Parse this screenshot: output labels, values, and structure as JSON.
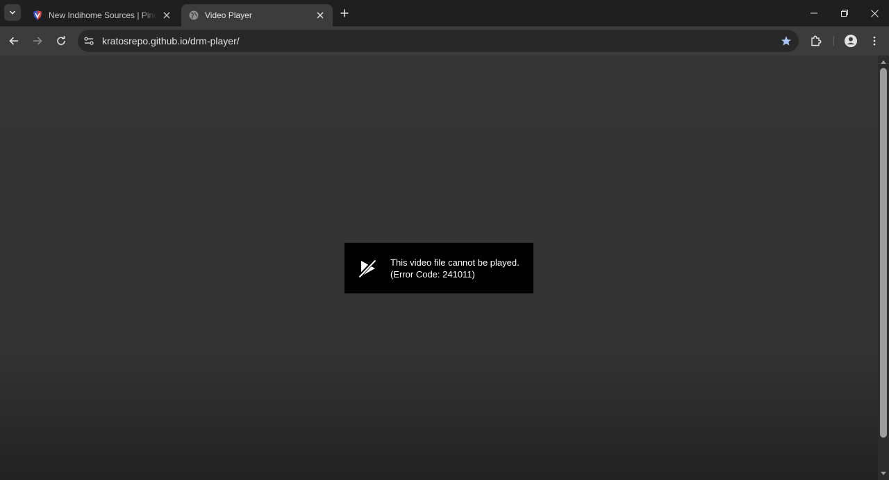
{
  "tabs": [
    {
      "title": "New Indihome Sources | Pinoy IPTV",
      "active": false,
      "favicon": "shield-favicon"
    },
    {
      "title": "Video Player",
      "active": true,
      "favicon": "globe-icon"
    }
  ],
  "address_bar": {
    "url": "kratosrepo.github.io/drm-player/"
  },
  "player_error": {
    "message": "This video file cannot be played.",
    "code_text": "(Error Code: 241011)"
  },
  "colors": {
    "accent_star": "#a8c7fa",
    "error_bg": "#000000"
  }
}
